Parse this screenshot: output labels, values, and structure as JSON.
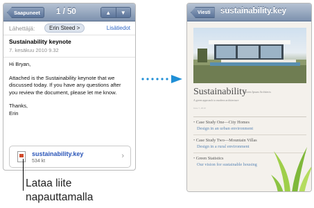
{
  "mail": {
    "back_button": "Saapuneet",
    "counter": "1 / 50",
    "nav_up": "▲",
    "nav_down": "▼",
    "from_label": "Lähettäjä:",
    "sender": "Erin Steed",
    "sender_chevron": ">",
    "details": "Lisätiedot",
    "subject": "Sustainability keynote",
    "date": "7. kesäkuu 2010 9.32",
    "greeting": "Hi Bryan,",
    "body": "Attached is the Sustainability keynote that we discussed today. If you have any questions after you review the document, please let me know.",
    "signoff_1": "Thanks,",
    "signoff_2": "Erin",
    "attachment": {
      "name": "sustainability.key",
      "size": "534 kt",
      "chevron": "›"
    }
  },
  "callout": {
    "line_1": "Lataa liite",
    "line_2": "napauttamalla"
  },
  "preview": {
    "back_button": "Viesti",
    "title": "sustainability.key",
    "slide": {
      "heading": "Sustainability",
      "heading_sub": "Lorem Ipsum Architects",
      "subline": "A green approach to modern architecture",
      "date": "June 7, 2010",
      "cases": [
        {
          "title": "Case Study One—City Homes",
          "desc": "Design in an urban environment"
        },
        {
          "title": "Case Study Two—Mountain Villas",
          "desc": "Design in a rural environment"
        },
        {
          "title": "Green Statistics",
          "desc": "Our vision for sustainable housing"
        }
      ]
    }
  },
  "colors": {
    "toolbar_top": "#b5c2d3",
    "toolbar_bottom": "#7d91ae",
    "link_blue": "#2d66c6",
    "arrow_blue": "#1f8fd6"
  }
}
